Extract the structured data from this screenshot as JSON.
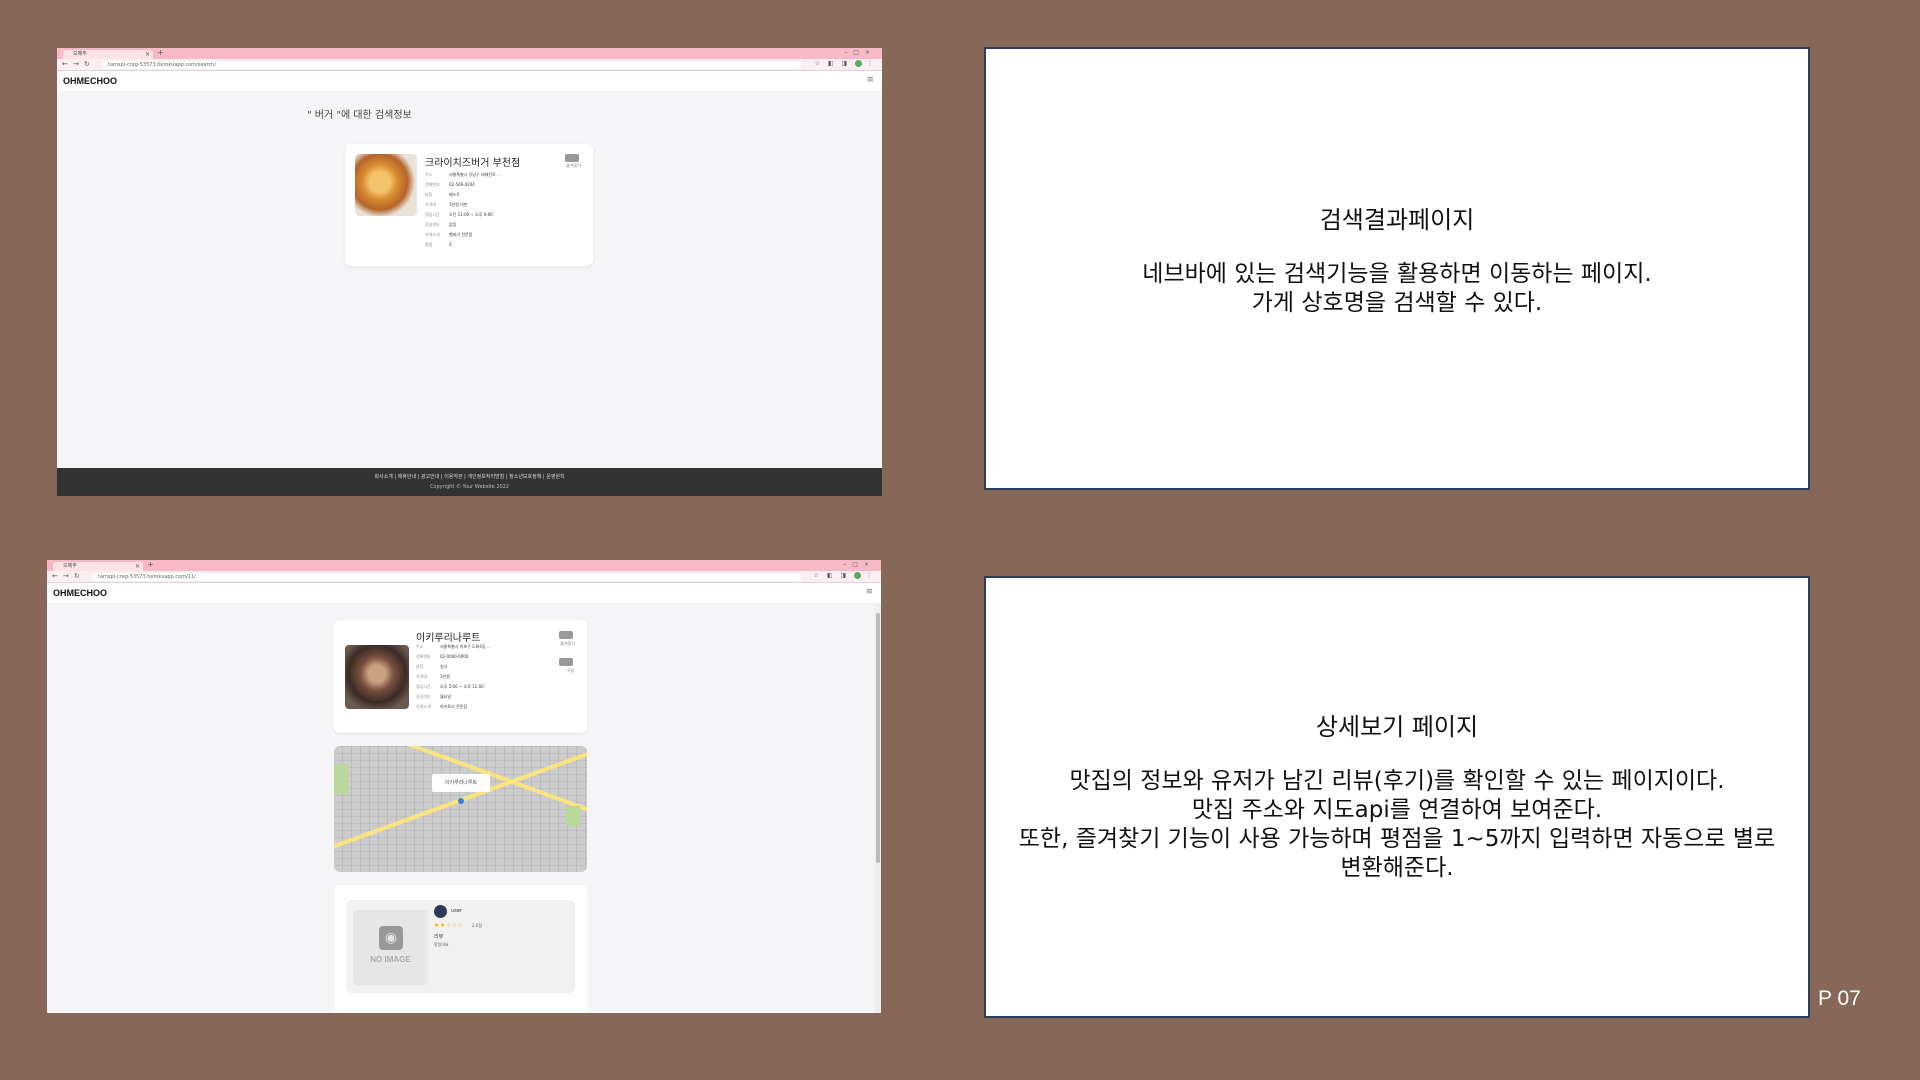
{
  "shot1": {
    "tab_title": "오메추",
    "url": "tamspl-crag-53573.herokuapp.com/search/",
    "brand": "OHMECHOO",
    "search_title": "\" 버거 \"에 대한 검색정보",
    "store_name": "크라이치즈버거 부천점",
    "fav_label": "즐겨찾기",
    "info_rows": [
      {
        "label": "주소",
        "value": "서울특별시 강남구 테헤란로 ..."
      },
      {
        "label": "전화번호",
        "value": "02-566-0244"
      },
      {
        "label": "분류",
        "value": "패스트"
      },
      {
        "label": "가격대",
        "value": "1만원 미만"
      },
      {
        "label": "영업시간",
        "value": "오전 11:00 ~ 오후 9:00"
      },
      {
        "label": "휴일여부",
        "value": "없음"
      },
      {
        "label": "가게소개",
        "value": "햄버거 전문점"
      },
      {
        "label": "평점",
        "value": "0"
      }
    ],
    "footer_links": "회사소개 | 제휴안내 | 광고안내 | 이용약관 | 개인정보처리방침 | 청소년보호정책 | 운영원칙",
    "footer_copy": "Copyright © Your Website 2022"
  },
  "shot2": {
    "tab_title": "오메추",
    "url": "tamspl-crag-53573.herokuapp.com/11/",
    "brand": "OHMECHOO",
    "store_name": "이키루리나루트",
    "fav_label": "즐겨찾기",
    "edit_label": "수정",
    "info_rows": [
      {
        "label": "주소",
        "value": "서울특별시 마포구 도화4길 ..."
      },
      {
        "label": "전화번호",
        "value": "02-0000-0000"
      },
      {
        "label": "분류",
        "value": "일식"
      },
      {
        "label": "가격대",
        "value": "1만원"
      },
      {
        "label": "영업시간",
        "value": "오후 5:00 ~ 오후 11:00"
      },
      {
        "label": "휴일여부",
        "value": "월요일"
      },
      {
        "label": "가게소개",
        "value": "야키토리 전문점"
      }
    ],
    "map_label": "이키루리나루트",
    "review": {
      "no_image": "NO IMAGE",
      "user": "user",
      "stars": "★★☆☆☆",
      "rating": "2.0점",
      "title": "리뷰",
      "body": "맛있어요"
    }
  },
  "panel1": {
    "title": "검색결과페이지",
    "lines": [
      "네브바에 있는 검색기능을 활용하면 이동하는 페이지.",
      "가게 상호명을 검색할 수 있다."
    ]
  },
  "panel2": {
    "title": "상세보기 페이지",
    "lines": [
      "맛집의 정보와 유저가 남긴 리뷰(후기)를 확인할 수 있는 페이지이다.",
      "맛집 주소와 지도api를 연결하여 보여준다.",
      "또한, 즐겨찾기 기능이 사용 가능하며 평점을 1~5까지 입력하면 자동으로 별로",
      "변환해준다."
    ]
  },
  "page_number": "P 07",
  "colors": {
    "background": "#876757",
    "panel_border": "#2e3d5a",
    "tab_bar": "#f7b9c6",
    "star": "#f0b400"
  }
}
